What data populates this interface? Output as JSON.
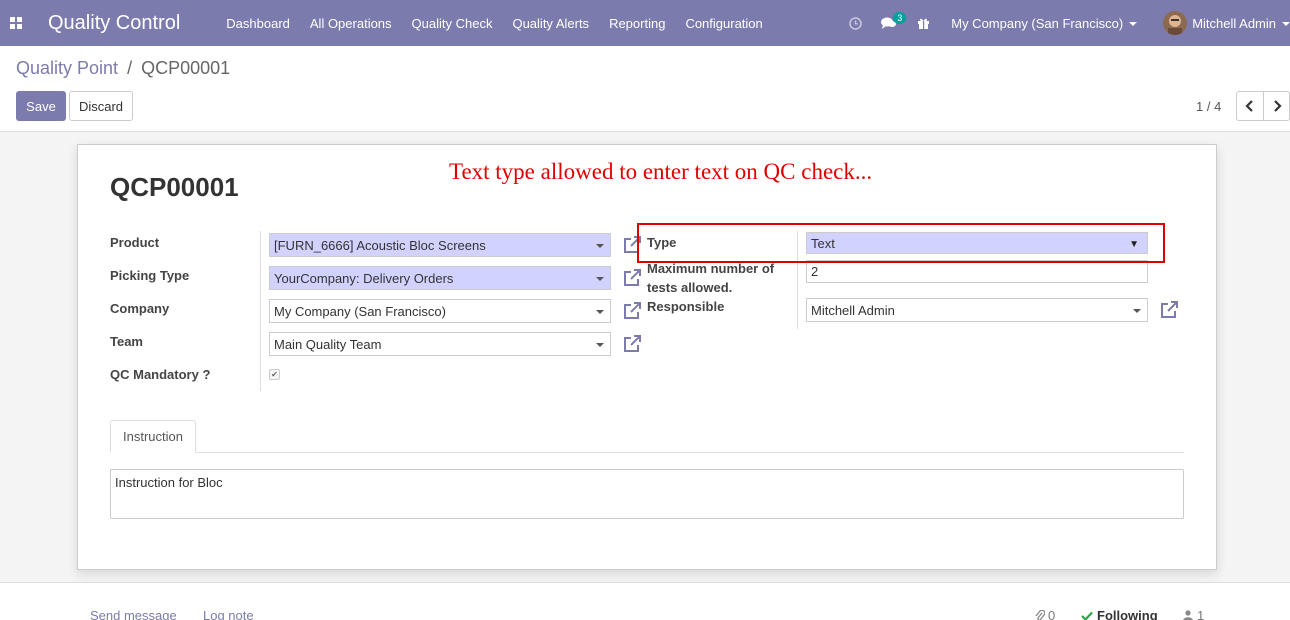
{
  "navbar": {
    "app_title": "Quality Control",
    "menu": [
      "Dashboard",
      "All Operations",
      "Quality Check",
      "Quality Alerts",
      "Reporting",
      "Configuration"
    ],
    "messages_badge": "3",
    "company": "My Company (San Francisco)",
    "user": "Mitchell Admin"
  },
  "breadcrumb": {
    "parent": "Quality Point",
    "separator": "/",
    "current": "QCP00001"
  },
  "buttons": {
    "save": "Save",
    "discard": "Discard"
  },
  "pager": {
    "value": "1 / 4"
  },
  "record": {
    "name": "QCP00001"
  },
  "annotation": "Text type allowed to enter text on QC check...",
  "left_fields": {
    "product": {
      "label": "Product",
      "value": "[FURN_6666] Acoustic Bloc Screens"
    },
    "picking_type": {
      "label": "Picking Type",
      "value": "YourCompany: Delivery Orders"
    },
    "company": {
      "label": "Company",
      "value": "My Company (San Francisco)"
    },
    "team": {
      "label": "Team",
      "value": "Main Quality Team"
    },
    "qc_mandatory": {
      "label": "QC Mandatory ?",
      "checked": true
    }
  },
  "right_fields": {
    "type": {
      "label": "Type",
      "value": "Text"
    },
    "max_tests": {
      "label_line1": "Maximum number of",
      "label_line2": "tests allowed.",
      "value": "2"
    },
    "responsible": {
      "label": "Responsible",
      "value": "Mitchell Admin"
    }
  },
  "tabs": {
    "instruction": "Instruction"
  },
  "instruction_text": "Instruction for Bloc",
  "chatter": {
    "send_message": "Send message",
    "log_note": "Log note",
    "attachments": "0",
    "following": "Following",
    "followers": "1"
  },
  "colors": {
    "brand": "#7c7bad",
    "required_bg": "#d2d2ff",
    "annotation": "#e00000",
    "badge": "#00a09d"
  }
}
